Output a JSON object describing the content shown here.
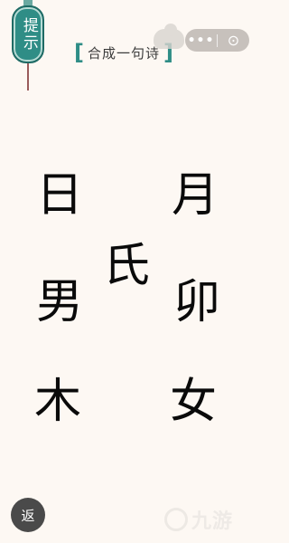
{
  "hint": {
    "label": "提示"
  },
  "title": {
    "text": "合成一句诗"
  },
  "capsule": {
    "more_symbol": "•••",
    "close_symbol": "⊙"
  },
  "characters": [
    "日",
    "月",
    "氏",
    "男",
    "卯",
    "木",
    "女"
  ],
  "back": {
    "label": "返"
  },
  "watermark": {
    "text": "九游"
  },
  "colors": {
    "background": "#fdf8f3",
    "accent": "#2f8d86",
    "ink": "#0a0a0a",
    "back_button": "#4a4a4a"
  }
}
